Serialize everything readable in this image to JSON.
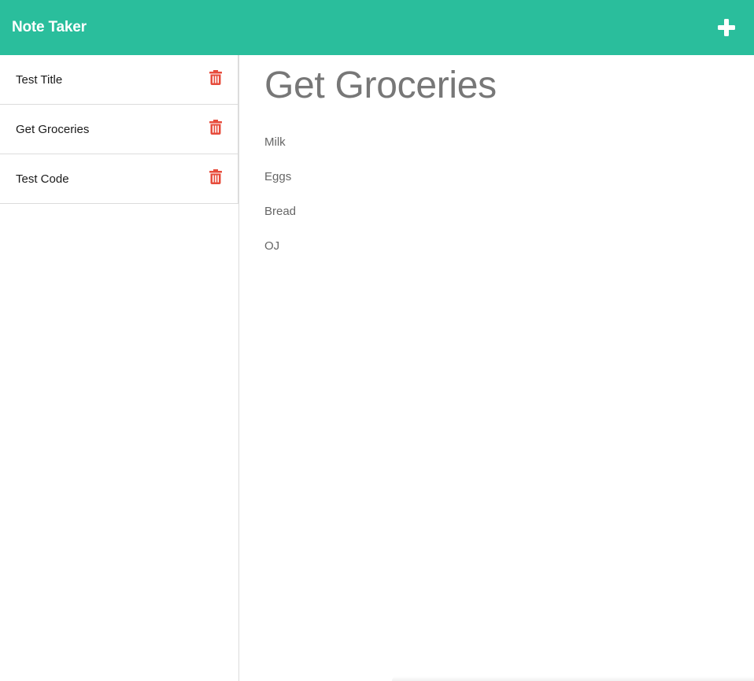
{
  "header": {
    "brand": "Note Taker",
    "new_note_icon": "plus-icon",
    "background_color": "#2abe9c"
  },
  "sidebar": {
    "notes": [
      {
        "title": "Test Title",
        "delete_icon": "trash-icon"
      },
      {
        "title": "Get Groceries",
        "delete_icon": "trash-icon"
      },
      {
        "title": "Test Code",
        "delete_icon": "trash-icon"
      }
    ],
    "delete_icon_color": "#e74c3c"
  },
  "main": {
    "note_title": "Get Groceries",
    "note_lines": [
      "Milk",
      "Eggs",
      "Bread",
      "OJ"
    ]
  }
}
